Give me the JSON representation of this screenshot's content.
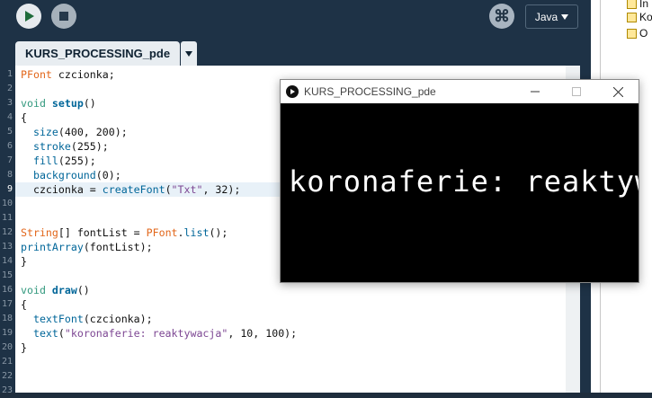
{
  "toolbar": {
    "mode_label": "Java",
    "debug_symbol": "⌘"
  },
  "tabs": [
    {
      "label": "KURS_PROCESSING_pde"
    }
  ],
  "editor": {
    "current_line": 9,
    "lines": [
      "PFont czcionka;",
      "",
      "void setup()",
      "{",
      "  size(400, 200);",
      "  stroke(255);",
      "  fill(255);",
      "  background(0);",
      "  czcionka = createFont(\"Txt\", 32);",
      "",
      "",
      "String[] fontList = PFont.list();",
      "printArray(fontList);",
      "}",
      "",
      "void draw()",
      "{",
      "  textFont(czcionka);",
      "  text(\"koronaferie: reaktywacja\", 10, 100);",
      "}",
      "",
      "",
      ""
    ],
    "line_numbers": [
      "1",
      "2",
      "3",
      "4",
      "5",
      "6",
      "7",
      "8",
      "9",
      "10",
      "11",
      "12",
      "13",
      "14",
      "15",
      "16",
      "17",
      "18",
      "19",
      "20",
      "21",
      "22",
      "23"
    ]
  },
  "sketch_window": {
    "title": "KURS_PROCESSING_pde",
    "canvas_text": "koronaferie: reaktywacja"
  },
  "right_panel": {
    "items": [
      {
        "label": "In"
      },
      {
        "label": "Ko"
      },
      {
        "label": "O"
      }
    ]
  },
  "colors": {
    "ide_background": "#1e3246",
    "keyword": "#33997e",
    "function": "#006699",
    "type": "#e2661a",
    "string": "#7d4793"
  }
}
